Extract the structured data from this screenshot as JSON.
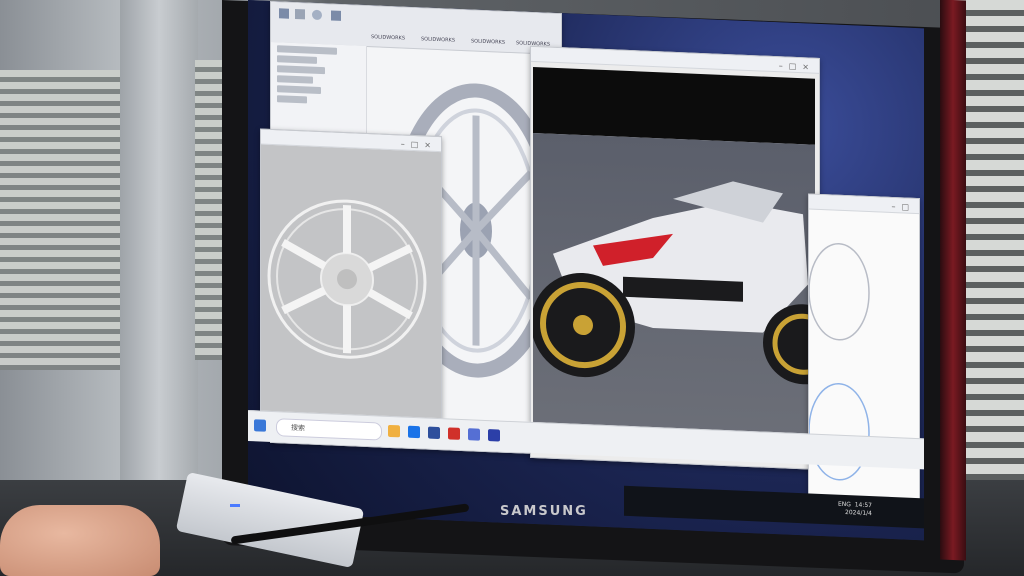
{
  "monitor": {
    "brand": "SAMSUNG"
  },
  "cad_window": {
    "tabs": [
      "SOLIDWORKS",
      "SOLIDWORKS",
      "SOLIDWORKS",
      "SOLIDWORKS"
    ]
  },
  "taskbar": {
    "search_placeholder": "搜索",
    "language": "ENG",
    "time": "14:57",
    "date": "2024/1/4"
  },
  "colors": {
    "wallpaper": "#1f2a5c",
    "bezel": "#141416",
    "bike_red": "#d0202a",
    "wheel_gold": "#c9a235"
  }
}
